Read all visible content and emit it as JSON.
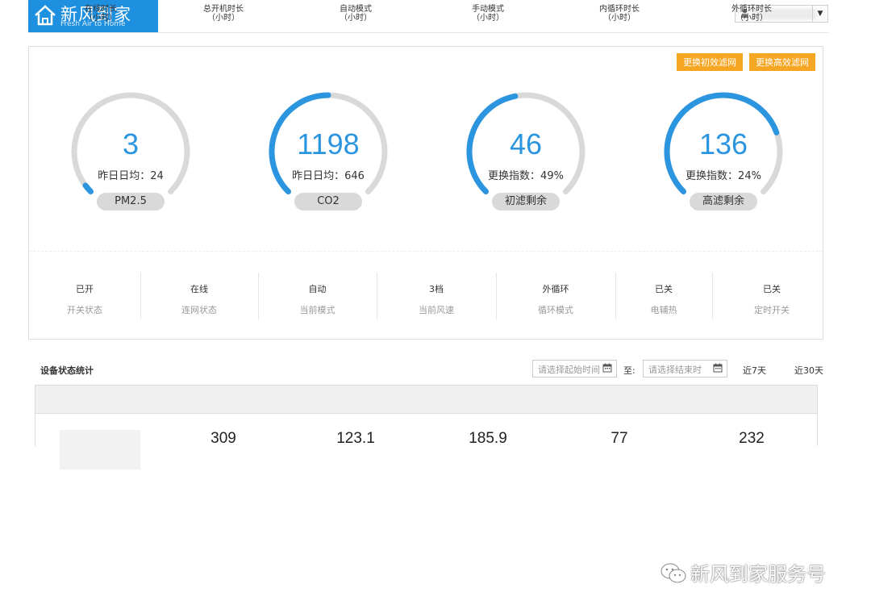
{
  "header": {
    "brand": "新风到家",
    "brand_sub": "Fresh Air to Home",
    "user_icon": "user-icon"
  },
  "actions": {
    "primary_filter_btn": "更换初效滤网",
    "hepa_filter_btn": "更换高效滤网"
  },
  "gauges": [
    {
      "value": "3",
      "sub": "昨日日均：24",
      "label": "PM2.5",
      "fill": 0.03
    },
    {
      "value": "1198",
      "sub": "昨日日均：646",
      "label": "CO2",
      "fill": 0.5
    },
    {
      "value": "46",
      "sub": "更换指数：49%",
      "label": "初滤剩余",
      "fill": 0.46
    },
    {
      "value": "136",
      "sub": "更换指数：24%",
      "label": "高滤剩余",
      "fill": 0.76
    }
  ],
  "colors": {
    "accent": "#2b95e0",
    "track": "#d9d9d9",
    "button": "#f5a623"
  },
  "status": [
    {
      "value": "已开",
      "label": "开关状态"
    },
    {
      "value": "在线",
      "label": "连网状态"
    },
    {
      "value": "自动",
      "label": "当前模式"
    },
    {
      "value": "3档",
      "label": "当前风速"
    },
    {
      "value": "外循环",
      "label": "循环模式"
    },
    {
      "value": "已关",
      "label": "电辅热"
    },
    {
      "value": "已关",
      "label": "定时开关"
    }
  ],
  "stats": {
    "title": "设备状态统计",
    "start_placeholder": "请选择起始时间",
    "to_label": "至:",
    "end_placeholder": "请选择结束时",
    "range_7": "近7天",
    "range_30": "近30天",
    "columns": [
      {
        "name": "在线时长",
        "unit": "（小时）"
      },
      {
        "name": "总开机时长",
        "unit": "（小时）"
      },
      {
        "name": "自动模式",
        "unit": "（小时）"
      },
      {
        "name": "手动模式",
        "unit": "（小时）"
      },
      {
        "name": "内循环时长",
        "unit": "（小时）"
      },
      {
        "name": "外循环时长",
        "unit": "（小时）"
      }
    ],
    "row": [
      "309",
      "123.1",
      "185.9",
      "77",
      "232"
    ]
  },
  "watermark": "新风到家服务号"
}
